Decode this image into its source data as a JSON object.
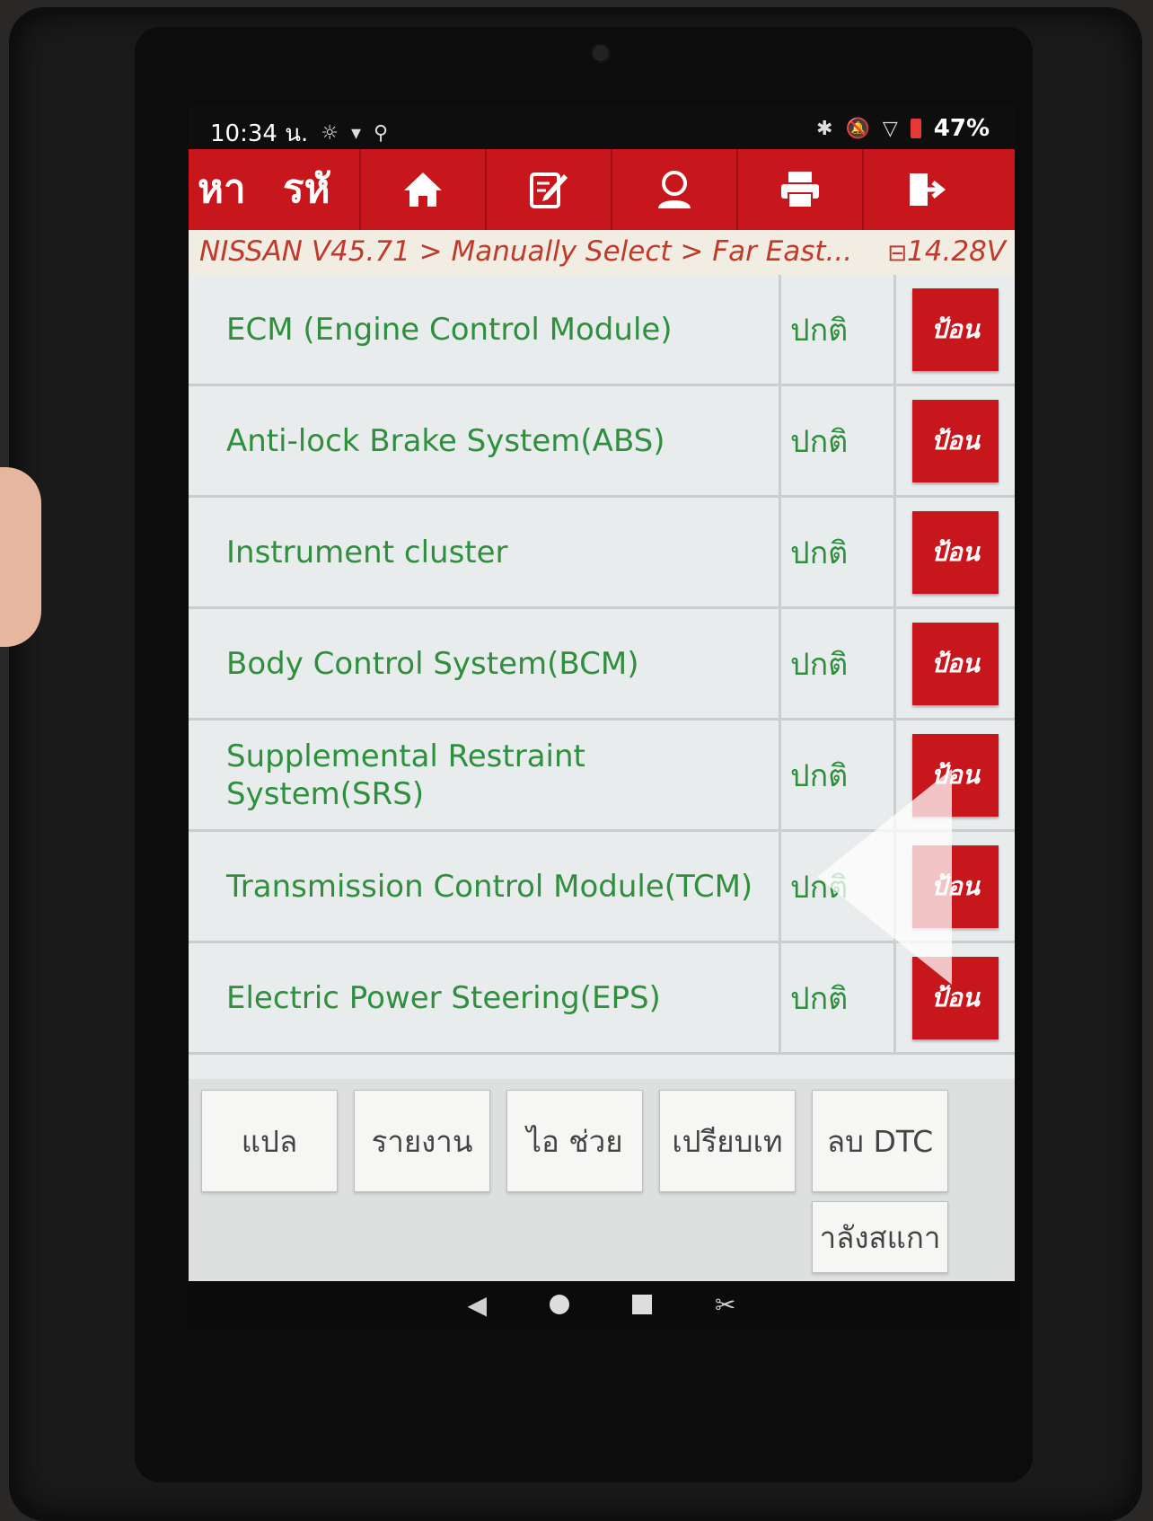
{
  "status_bar": {
    "time": "10:34 น.",
    "left_icons": [
      "☼",
      "▾",
      "⚲"
    ],
    "right_icons": [
      "✱",
      "🔕",
      "▽"
    ],
    "battery": "47%"
  },
  "toolbar": {
    "search_label": "หา",
    "code_label": "รหั",
    "buttons": [
      "home-icon",
      "edit-icon",
      "user-icon",
      "print-icon",
      "exit-icon"
    ]
  },
  "breadcrumb": {
    "path": "NISSAN V45.71 > Manually Select > Far East...",
    "voltage": "14.28V"
  },
  "systems": [
    {
      "name": "ECM (Engine Control Module)",
      "status": "ปกติ",
      "action": "ป้อน"
    },
    {
      "name": "Anti-lock Brake System(ABS)",
      "status": "ปกติ",
      "action": "ป้อน"
    },
    {
      "name": "Instrument cluster",
      "status": "ปกติ",
      "action": "ป้อน"
    },
    {
      "name": "Body Control System(BCM)",
      "status": "ปกติ",
      "action": "ป้อน"
    },
    {
      "name": "Supplemental Restraint System(SRS)",
      "status": "ปกติ",
      "action": "ป้อน"
    },
    {
      "name": "Transmission Control Module(TCM)",
      "status": "ปกติ",
      "action": "ป้อน"
    },
    {
      "name": "Electric Power Steering(EPS)",
      "status": "ปกติ",
      "action": "ป้อน"
    }
  ],
  "bottom_buttons": {
    "translate": "แปล",
    "report": "รายงาน",
    "help": "ไอ    ช่วย",
    "compare": "เปรียบเท",
    "clear_dtc": "ลบ DTC",
    "rescan": "าลังสแกา"
  },
  "nav": {
    "back": "◀",
    "screenshot": "✂"
  },
  "colors": {
    "brand_red": "#c8161d",
    "text_green": "#2f8f3e",
    "crumb_red": "#c0392b"
  }
}
